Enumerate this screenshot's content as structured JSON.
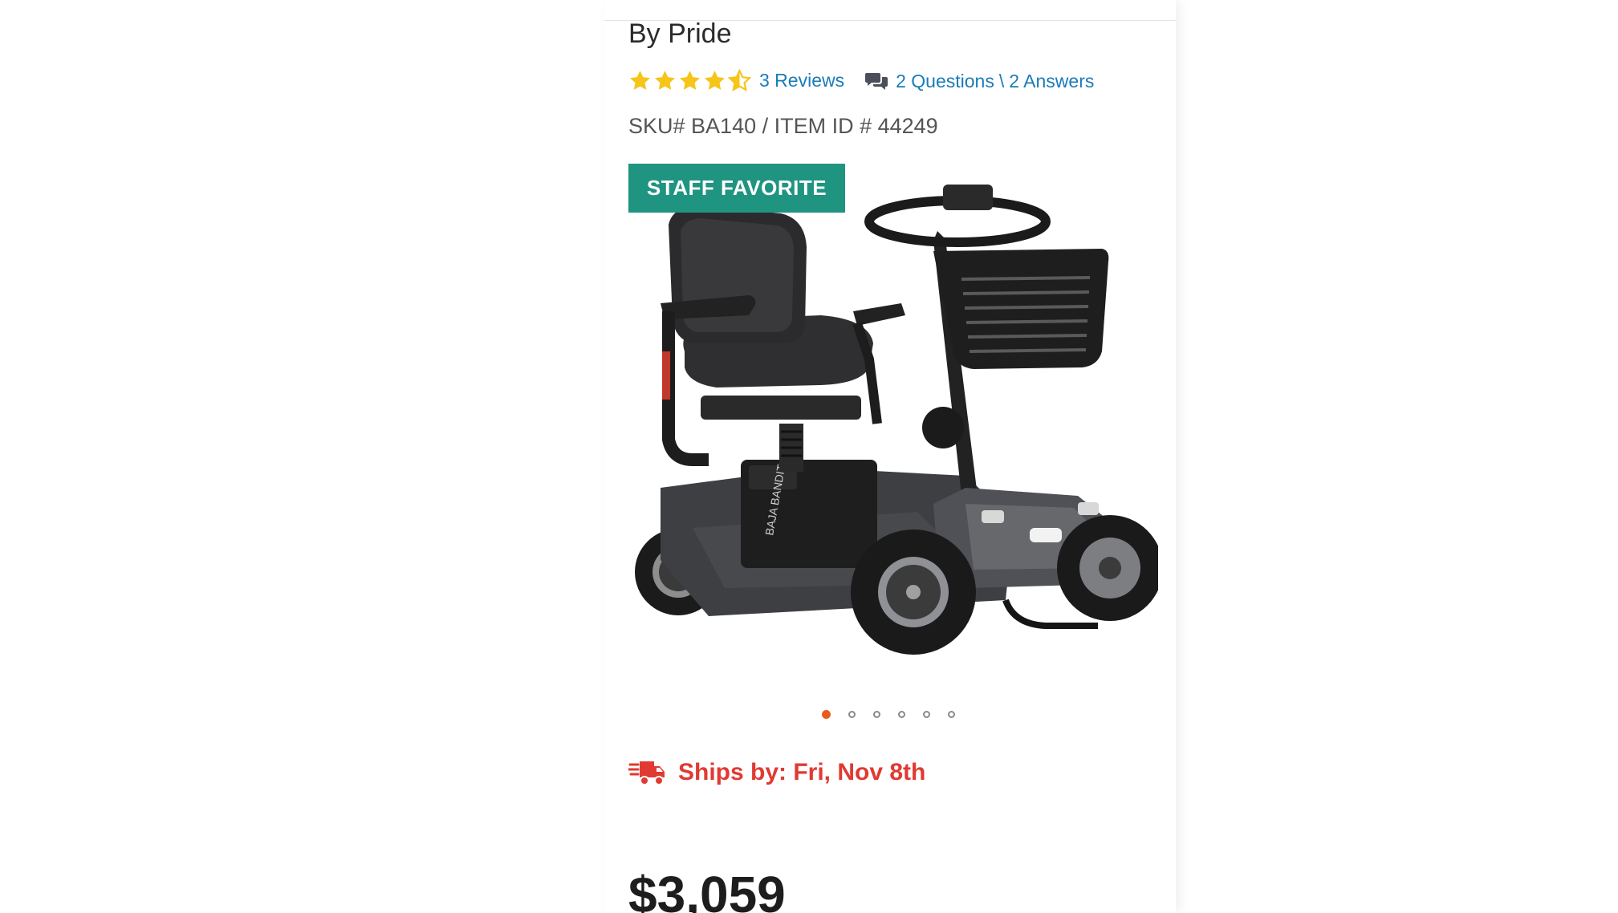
{
  "product": {
    "brand_line": "By Pride",
    "rating": {
      "stars": 4.5,
      "max_stars": 5,
      "reviews_label": "3 Reviews",
      "questions_label": "2 Questions",
      "qa_separator": "\\",
      "answers_label": "2 Answers"
    },
    "sku_line": "SKU# BA140 / ITEM ID # 44249",
    "badge_label": "STAFF FAVORITE",
    "image_icon": "mobility-scooter-image",
    "carousel": {
      "total_dots": 6,
      "active_index": 0
    },
    "shipping": {
      "icon": "fast-delivery-truck-icon",
      "text": "Ships by: Fri, Nov 8th"
    },
    "price": "$3,059"
  },
  "colors": {
    "link": "#1a7bb8",
    "star": "#f5c518",
    "badge_bg": "#1f9480",
    "ship_red": "#e03a32",
    "dot_active": "#e85b1a",
    "price_text": "#1d1d1d"
  }
}
